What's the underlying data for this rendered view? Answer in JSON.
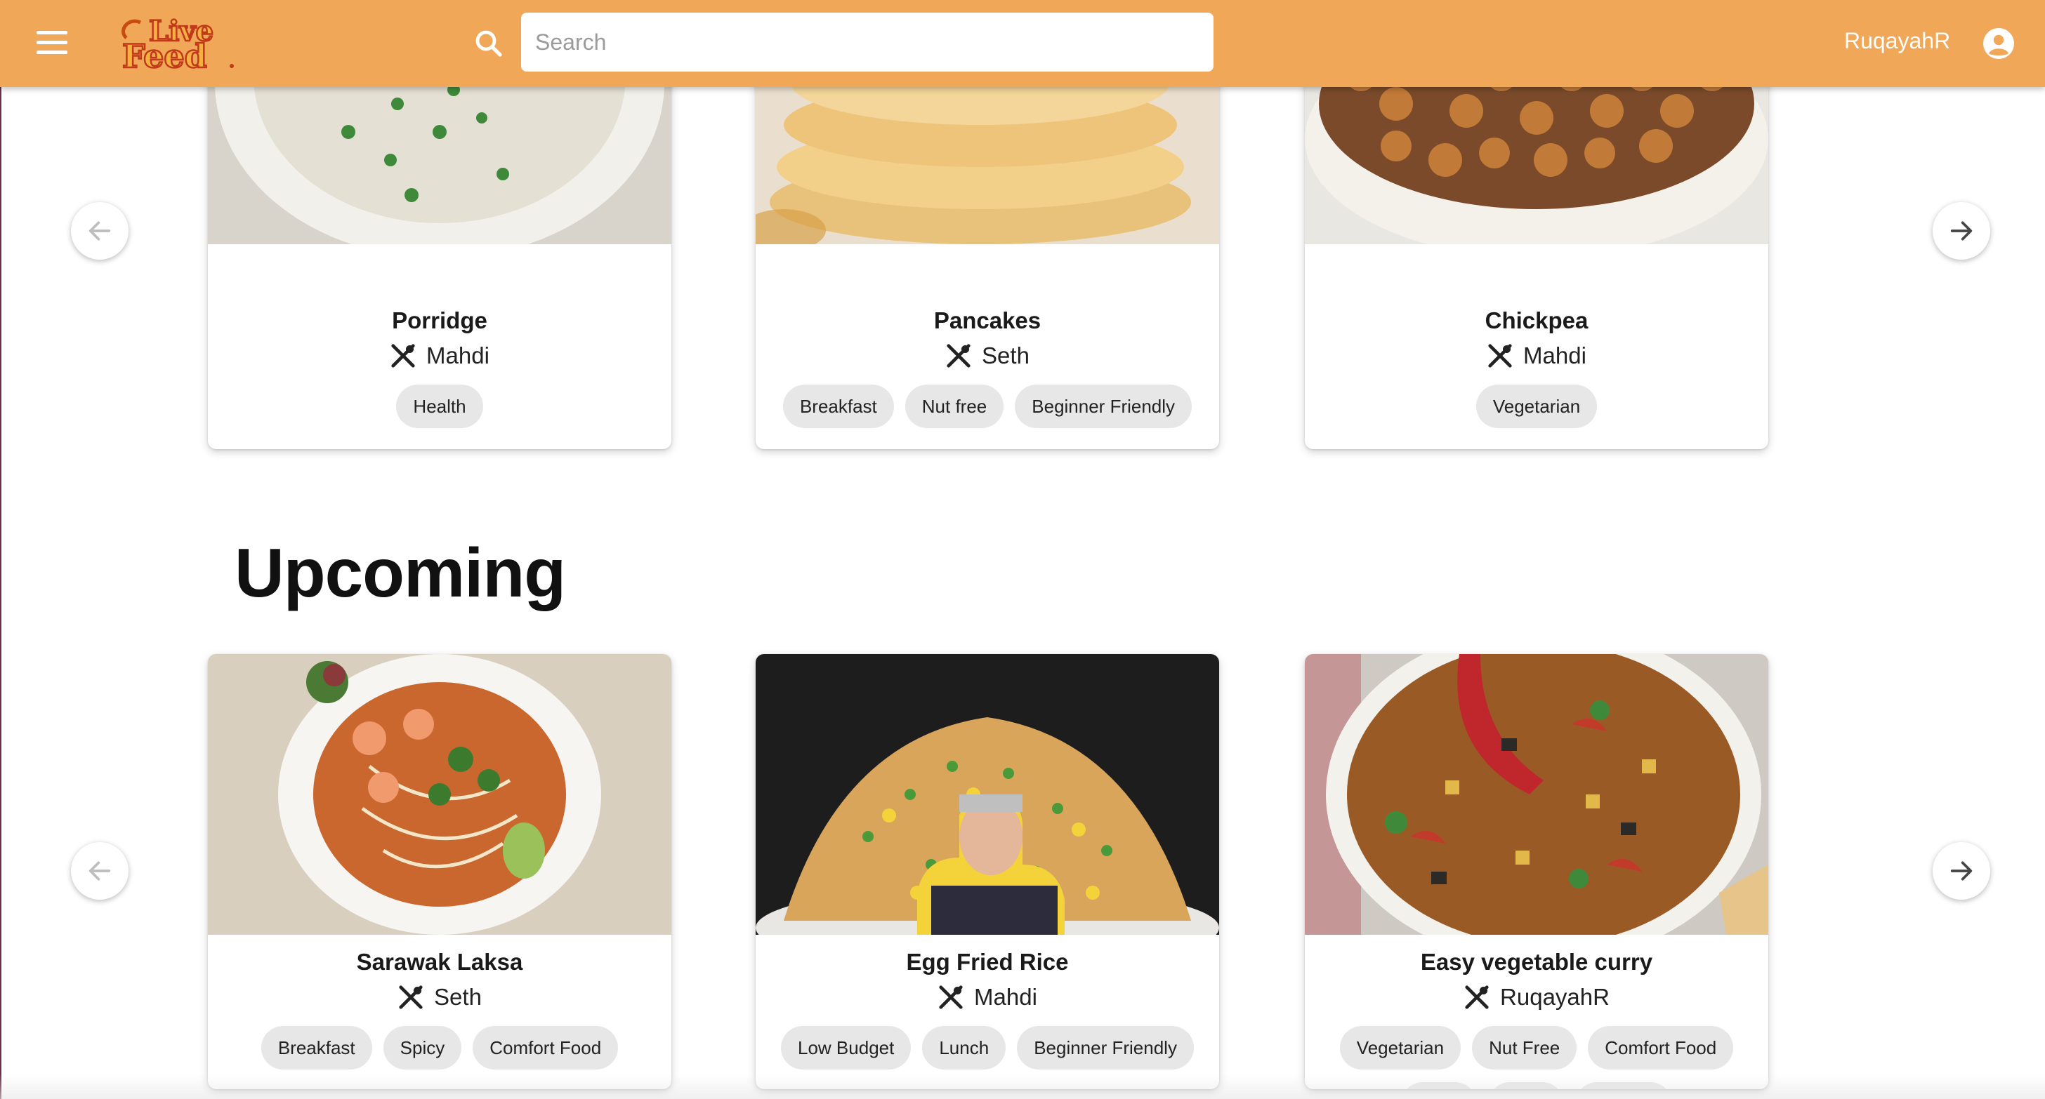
{
  "header": {
    "logo_text": "Live Feed",
    "search_placeholder": "Search",
    "username": "RuqayahR"
  },
  "featured": {
    "cards": [
      {
        "title": "Porridge",
        "author": "Mahdi",
        "tags": [
          "Health"
        ]
      },
      {
        "title": "Pancakes",
        "author": "Seth",
        "tags": [
          "Breakfast",
          "Nut free",
          "Beginner Friendly"
        ]
      },
      {
        "title": "Chickpea",
        "author": "Mahdi",
        "tags": [
          "Vegetarian"
        ]
      }
    ]
  },
  "upcoming": {
    "heading": "Upcoming",
    "cards": [
      {
        "title": "Sarawak Laksa",
        "author": "Seth",
        "tags": [
          "Breakfast",
          "Spicy",
          "Comfort Food"
        ]
      },
      {
        "title": "Egg Fried Rice",
        "author": "Mahdi",
        "tags": [
          "Low Budget",
          "Lunch",
          "Beginner Friendly"
        ]
      },
      {
        "title": "Easy vegetable curry",
        "author": "RuqayahR",
        "tags": [
          "Vegetarian",
          "Nut Free",
          "Comfort Food"
        ]
      }
    ]
  },
  "colors": {
    "appbar": "#f0a858",
    "tag_bg": "#e7e7e7"
  },
  "icons": [
    "menu-icon",
    "search-icon",
    "account-circle-icon",
    "utensils-icon",
    "arrow-left-icon",
    "arrow-right-icon"
  ]
}
